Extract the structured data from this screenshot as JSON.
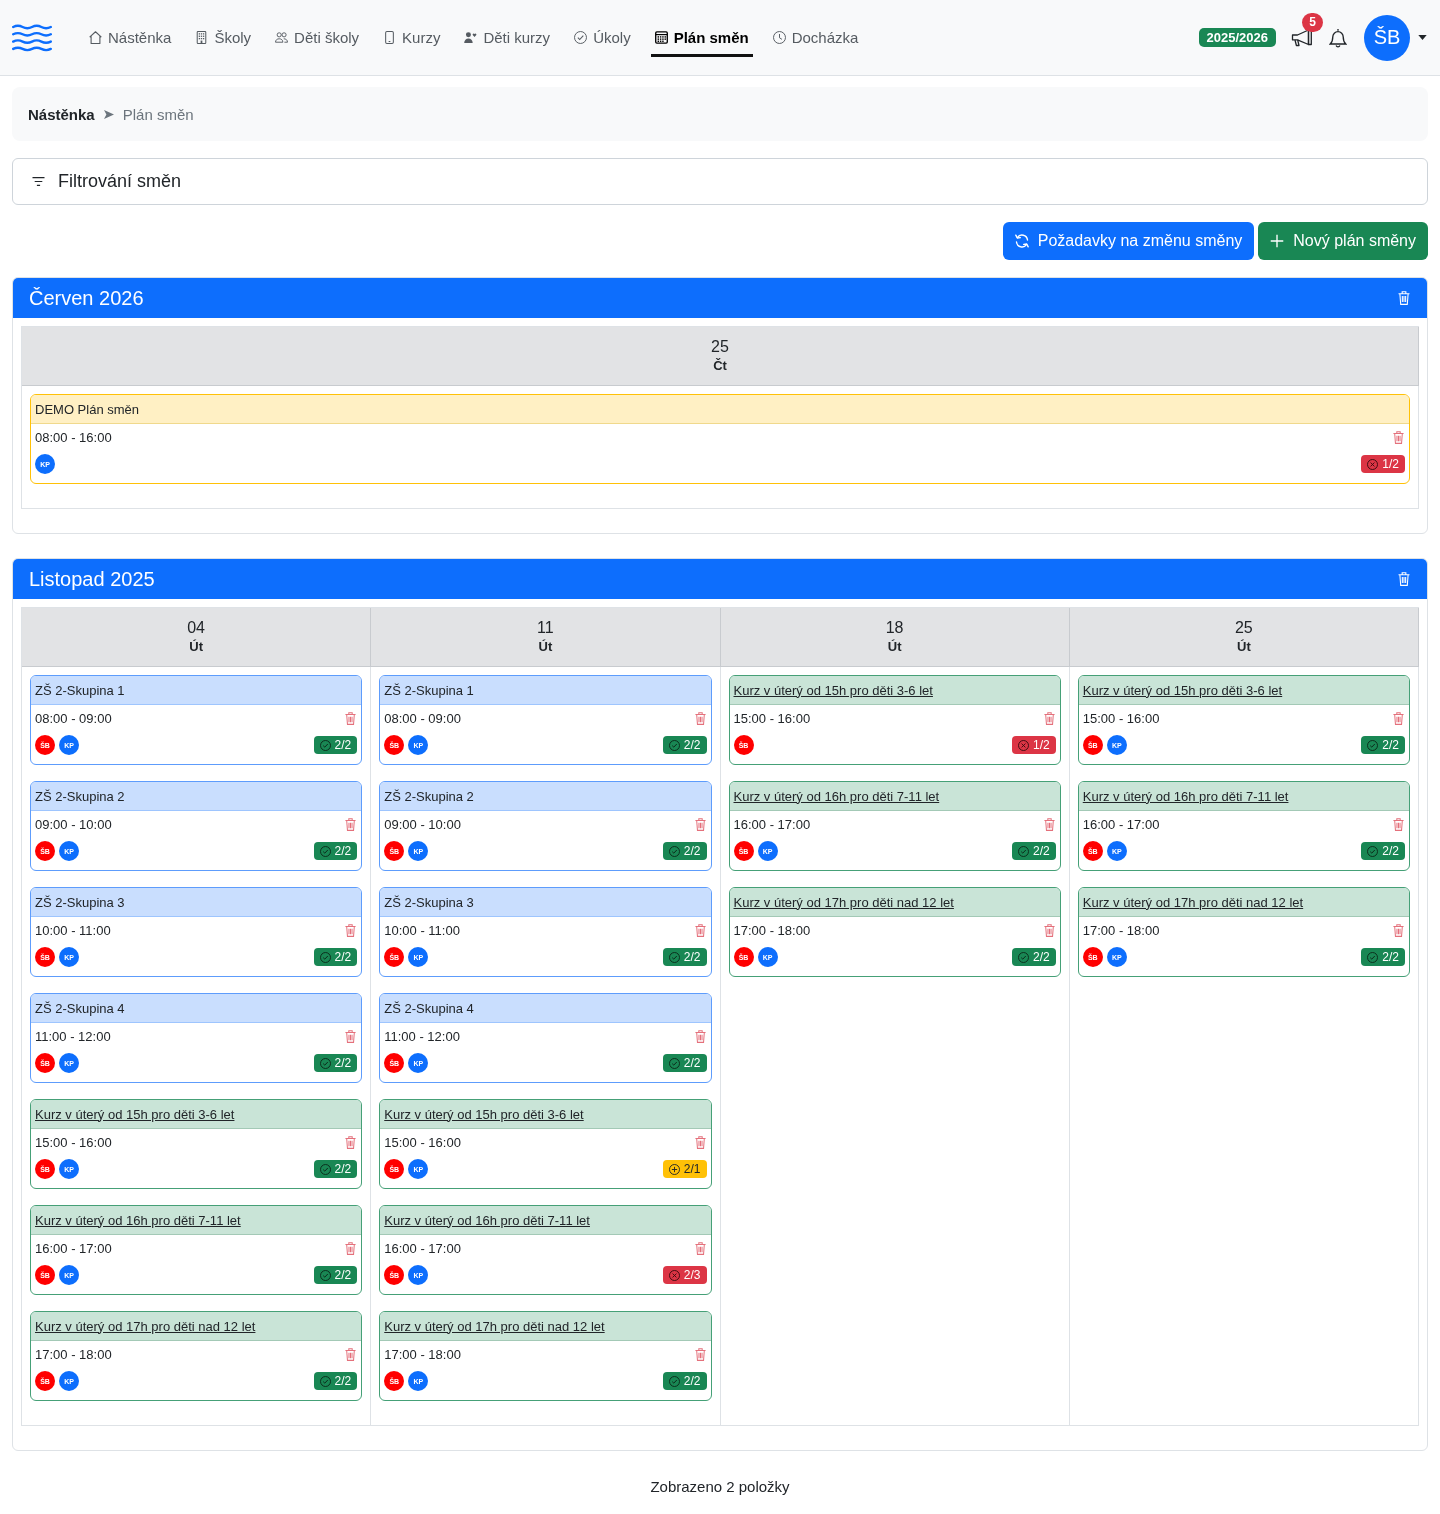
{
  "navbar": {
    "items": [
      {
        "label": "Nástěnka",
        "selected": false
      },
      {
        "label": "Školy",
        "selected": false
      },
      {
        "label": "Děti školy",
        "selected": false
      },
      {
        "label": "Kurzy",
        "selected": false
      },
      {
        "label": "Děti kurzy",
        "selected": false
      },
      {
        "label": "Úkoly",
        "selected": false
      },
      {
        "label": "Plán směn",
        "selected": true
      },
      {
        "label": "Docházka",
        "selected": false
      }
    ],
    "school_year": "2025/2026",
    "announcements_count": "5",
    "user_initials": "ŠB"
  },
  "breadcrumb": [
    {
      "label": "Nástěnka",
      "current": false
    },
    {
      "label": "Plán směn",
      "current": true
    }
  ],
  "filter": {
    "title": "Filtrování směn"
  },
  "actions": [
    {
      "label": "Požadavky na změnu směny",
      "kind": "requests"
    },
    {
      "label": "Nový plán směny",
      "kind": "create"
    }
  ],
  "plans": [
    {
      "title": "Červen 2026",
      "days": [
        {
          "date": "25",
          "weekday": "Čt",
          "shifts": [
            {
              "title": "DEMO Plán směn",
              "kind": "demo",
              "time": "08:00 - 16:00",
              "staff": [
                {
                  "initials": "KP",
                  "color": "#0d6efd"
                }
              ],
              "staffing": {
                "kind": "short",
                "count": "1/2"
              }
            }
          ]
        }
      ]
    },
    {
      "title": "Listopad 2025",
      "days": [
        {
          "date": "04",
          "weekday": "Út",
          "shifts": [
            {
              "title": "ZŠ 2-Skupina 1",
              "kind": "school",
              "time": "08:00 - 09:00",
              "staff": [
                {
                  "initials": "ŠB",
                  "color": "#ff0000"
                },
                {
                  "initials": "KP",
                  "color": "#0d6efd"
                }
              ],
              "staffing": {
                "kind": "full",
                "count": "2/2"
              }
            },
            {
              "title": "ZŠ 2-Skupina 2",
              "kind": "school",
              "time": "09:00 - 10:00",
              "staff": [
                {
                  "initials": "ŠB",
                  "color": "#ff0000"
                },
                {
                  "initials": "KP",
                  "color": "#0d6efd"
                }
              ],
              "staffing": {
                "kind": "full",
                "count": "2/2"
              }
            },
            {
              "title": "ZŠ 2-Skupina 3",
              "kind": "school",
              "time": "10:00 - 11:00",
              "staff": [
                {
                  "initials": "ŠB",
                  "color": "#ff0000"
                },
                {
                  "initials": "KP",
                  "color": "#0d6efd"
                }
              ],
              "staffing": {
                "kind": "full",
                "count": "2/2"
              }
            },
            {
              "title": "ZŠ 2-Skupina 4",
              "kind": "school",
              "time": "11:00 - 12:00",
              "staff": [
                {
                  "initials": "ŠB",
                  "color": "#ff0000"
                },
                {
                  "initials": "KP",
                  "color": "#0d6efd"
                }
              ],
              "staffing": {
                "kind": "full",
                "count": "2/2"
              }
            },
            {
              "title": "Kurz v úterý od 15h pro děti 3-6 let",
              "kind": "course",
              "time": "15:00 - 16:00",
              "staff": [
                {
                  "initials": "ŠB",
                  "color": "#ff0000"
                },
                {
                  "initials": "KP",
                  "color": "#0d6efd"
                }
              ],
              "staffing": {
                "kind": "full",
                "count": "2/2"
              }
            },
            {
              "title": "Kurz v úterý od 16h pro děti 7-11 let",
              "kind": "course",
              "time": "16:00 - 17:00",
              "staff": [
                {
                  "initials": "ŠB",
                  "color": "#ff0000"
                },
                {
                  "initials": "KP",
                  "color": "#0d6efd"
                }
              ],
              "staffing": {
                "kind": "full",
                "count": "2/2"
              }
            },
            {
              "title": "Kurz v úterý od 17h pro děti nad 12 let",
              "kind": "course",
              "time": "17:00 - 18:00",
              "staff": [
                {
                  "initials": "ŠB",
                  "color": "#ff0000"
                },
                {
                  "initials": "KP",
                  "color": "#0d6efd"
                }
              ],
              "staffing": {
                "kind": "full",
                "count": "2/2"
              }
            }
          ]
        },
        {
          "date": "11",
          "weekday": "Út",
          "shifts": [
            {
              "title": "ZŠ 2-Skupina 1",
              "kind": "school",
              "time": "08:00 - 09:00",
              "staff": [
                {
                  "initials": "ŠB",
                  "color": "#ff0000"
                },
                {
                  "initials": "KP",
                  "color": "#0d6efd"
                }
              ],
              "staffing": {
                "kind": "full",
                "count": "2/2"
              }
            },
            {
              "title": "ZŠ 2-Skupina 2",
              "kind": "school",
              "time": "09:00 - 10:00",
              "staff": [
                {
                  "initials": "ŠB",
                  "color": "#ff0000"
                },
                {
                  "initials": "KP",
                  "color": "#0d6efd"
                }
              ],
              "staffing": {
                "kind": "full",
                "count": "2/2"
              }
            },
            {
              "title": "ZŠ 2-Skupina 3",
              "kind": "school",
              "time": "10:00 - 11:00",
              "staff": [
                {
                  "initials": "ŠB",
                  "color": "#ff0000"
                },
                {
                  "initials": "KP",
                  "color": "#0d6efd"
                }
              ],
              "staffing": {
                "kind": "full",
                "count": "2/2"
              }
            },
            {
              "title": "ZŠ 2-Skupina 4",
              "kind": "school",
              "time": "11:00 - 12:00",
              "staff": [
                {
                  "initials": "ŠB",
                  "color": "#ff0000"
                },
                {
                  "initials": "KP",
                  "color": "#0d6efd"
                }
              ],
              "staffing": {
                "kind": "full",
                "count": "2/2"
              }
            },
            {
              "title": "Kurz v úterý od 15h pro děti 3-6 let",
              "kind": "course",
              "time": "15:00 - 16:00",
              "staff": [
                {
                  "initials": "ŠB",
                  "color": "#ff0000"
                },
                {
                  "initials": "KP",
                  "color": "#0d6efd"
                }
              ],
              "staffing": {
                "kind": "over",
                "count": "2/1"
              }
            },
            {
              "title": "Kurz v úterý od 16h pro děti 7-11 let",
              "kind": "course",
              "time": "16:00 - 17:00",
              "staff": [
                {
                  "initials": "ŠB",
                  "color": "#ff0000"
                },
                {
                  "initials": "KP",
                  "color": "#0d6efd"
                }
              ],
              "staffing": {
                "kind": "short",
                "count": "2/3"
              }
            },
            {
              "title": "Kurz v úterý od 17h pro děti nad 12 let",
              "kind": "course",
              "time": "17:00 - 18:00",
              "staff": [
                {
                  "initials": "ŠB",
                  "color": "#ff0000"
                },
                {
                  "initials": "KP",
                  "color": "#0d6efd"
                }
              ],
              "staffing": {
                "kind": "full",
                "count": "2/2"
              }
            }
          ]
        },
        {
          "date": "18",
          "weekday": "Út",
          "shifts": [
            {
              "title": "Kurz v úterý od 15h pro děti 3-6 let",
              "kind": "course",
              "time": "15:00 - 16:00",
              "staff": [
                {
                  "initials": "ŠB",
                  "color": "#ff0000"
                }
              ],
              "staffing": {
                "kind": "short",
                "count": "1/2"
              }
            },
            {
              "title": "Kurz v úterý od 16h pro děti 7-11 let",
              "kind": "course",
              "time": "16:00 - 17:00",
              "staff": [
                {
                  "initials": "ŠB",
                  "color": "#ff0000"
                },
                {
                  "initials": "KP",
                  "color": "#0d6efd"
                }
              ],
              "staffing": {
                "kind": "full",
                "count": "2/2"
              }
            },
            {
              "title": "Kurz v úterý od 17h pro děti nad 12 let",
              "kind": "course",
              "time": "17:00 - 18:00",
              "staff": [
                {
                  "initials": "ŠB",
                  "color": "#ff0000"
                },
                {
                  "initials": "KP",
                  "color": "#0d6efd"
                }
              ],
              "staffing": {
                "kind": "full",
                "count": "2/2"
              }
            }
          ]
        },
        {
          "date": "25",
          "weekday": "Út",
          "shifts": [
            {
              "title": "Kurz v úterý od 15h pro děti 3-6 let",
              "kind": "course",
              "time": "15:00 - 16:00",
              "staff": [
                {
                  "initials": "ŠB",
                  "color": "#ff0000"
                },
                {
                  "initials": "KP",
                  "color": "#0d6efd"
                }
              ],
              "staffing": {
                "kind": "full",
                "count": "2/2"
              }
            },
            {
              "title": "Kurz v úterý od 16h pro děti 7-11 let",
              "kind": "course",
              "time": "16:00 - 17:00",
              "staff": [
                {
                  "initials": "ŠB",
                  "color": "#ff0000"
                },
                {
                  "initials": "KP",
                  "color": "#0d6efd"
                }
              ],
              "staffing": {
                "kind": "full",
                "count": "2/2"
              }
            },
            {
              "title": "Kurz v úterý od 17h pro děti nad 12 let",
              "kind": "course",
              "time": "17:00 - 18:00",
              "staff": [
                {
                  "initials": "ŠB",
                  "color": "#ff0000"
                },
                {
                  "initials": "KP",
                  "color": "#0d6efd"
                }
              ],
              "staffing": {
                "kind": "full",
                "count": "2/2"
              }
            }
          ]
        }
      ]
    }
  ],
  "footer": "Zobrazeno 2 položky"
}
